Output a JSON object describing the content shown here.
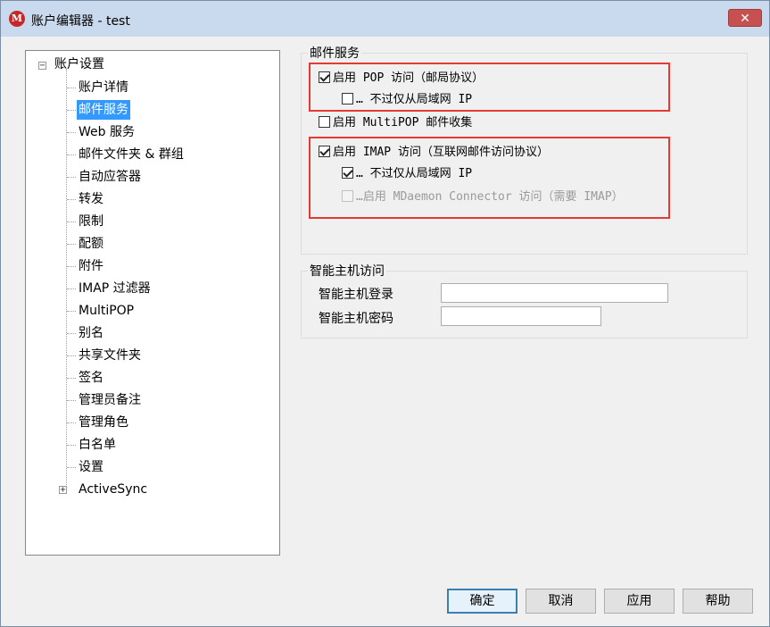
{
  "window": {
    "title": "账户编辑器 - test",
    "icon": "mdaemon-logo-icon",
    "close_label": "✕"
  },
  "tree": {
    "root": "账户设置",
    "items": [
      "账户详情",
      "邮件服务",
      "Web 服务",
      "邮件文件夹 & 群组",
      "自动应答器",
      "转发",
      "限制",
      "配额",
      "附件",
      "IMAP 过滤器",
      "MultiPOP",
      "别名",
      "共享文件夹",
      "签名",
      "管理员备注",
      "管理角色",
      "白名单",
      "设置"
    ],
    "selected": "邮件服务",
    "last": "ActiveSync"
  },
  "mail_services": {
    "group_title": "邮件服务",
    "pop_enable": "启用 POP 访问（邮局协议）",
    "pop_lan": "… 不过仅从局域网 IP",
    "multipop": "启用 MultiPOP 邮件收集",
    "imap_enable": "启用 IMAP 访问（互联网邮件访问协议）",
    "imap_lan": "… 不过仅从局域网 IP",
    "imap_connector": "…启用 MDaemon Connector 访问（需要 IMAP）"
  },
  "smart_host": {
    "group_title": "智能主机访问",
    "login_label": "智能主机登录",
    "login_value": "",
    "password_label": "智能主机密码",
    "password_value": ""
  },
  "buttons": {
    "ok": "确定",
    "cancel": "取消",
    "apply": "应用",
    "help": "帮助"
  },
  "colors": {
    "selection": "#3399ff",
    "highlight_box": "#e53935",
    "titlebar": "#c9d9ee"
  }
}
